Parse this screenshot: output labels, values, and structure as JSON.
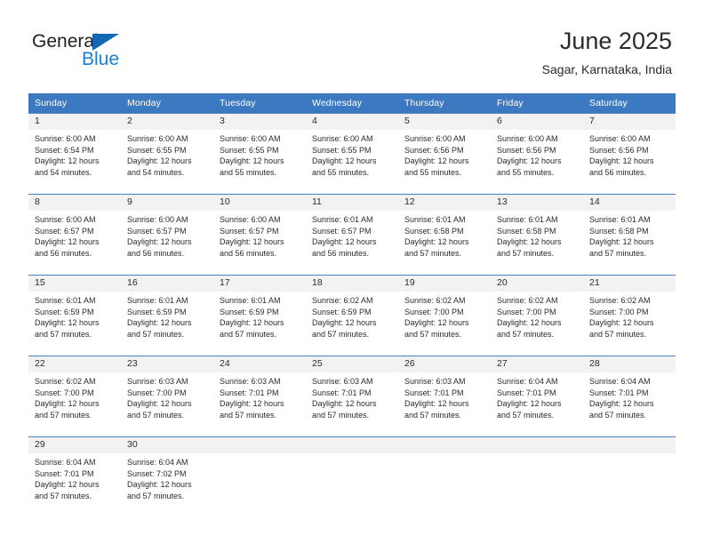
{
  "brand": {
    "name_top": "General",
    "name_bottom": "Blue",
    "triangle_color": "#1268b3",
    "blue_color": "#1a7fd4"
  },
  "header": {
    "title": "June 2025",
    "location": "Sagar, Karnataka, India"
  },
  "theme": {
    "header_blue": "#3d79c1",
    "daynum_strip": "#f2f2f2",
    "text": "#2b2b2b",
    "row_divider": "#4a7fc2"
  },
  "weekdays": [
    "Sunday",
    "Monday",
    "Tuesday",
    "Wednesday",
    "Thursday",
    "Friday",
    "Saturday"
  ],
  "weeks": [
    [
      {
        "day": "1",
        "sunrise": "Sunrise: 6:00 AM",
        "sunset": "Sunset: 6:54 PM",
        "daylight_line1": "Daylight: 12 hours",
        "daylight_line2": "and 54 minutes."
      },
      {
        "day": "2",
        "sunrise": "Sunrise: 6:00 AM",
        "sunset": "Sunset: 6:55 PM",
        "daylight_line1": "Daylight: 12 hours",
        "daylight_line2": "and 54 minutes."
      },
      {
        "day": "3",
        "sunrise": "Sunrise: 6:00 AM",
        "sunset": "Sunset: 6:55 PM",
        "daylight_line1": "Daylight: 12 hours",
        "daylight_line2": "and 55 minutes."
      },
      {
        "day": "4",
        "sunrise": "Sunrise: 6:00 AM",
        "sunset": "Sunset: 6:55 PM",
        "daylight_line1": "Daylight: 12 hours",
        "daylight_line2": "and 55 minutes."
      },
      {
        "day": "5",
        "sunrise": "Sunrise: 6:00 AM",
        "sunset": "Sunset: 6:56 PM",
        "daylight_line1": "Daylight: 12 hours",
        "daylight_line2": "and 55 minutes."
      },
      {
        "day": "6",
        "sunrise": "Sunrise: 6:00 AM",
        "sunset": "Sunset: 6:56 PM",
        "daylight_line1": "Daylight: 12 hours",
        "daylight_line2": "and 55 minutes."
      },
      {
        "day": "7",
        "sunrise": "Sunrise: 6:00 AM",
        "sunset": "Sunset: 6:56 PM",
        "daylight_line1": "Daylight: 12 hours",
        "daylight_line2": "and 56 minutes."
      }
    ],
    [
      {
        "day": "8",
        "sunrise": "Sunrise: 6:00 AM",
        "sunset": "Sunset: 6:57 PM",
        "daylight_line1": "Daylight: 12 hours",
        "daylight_line2": "and 56 minutes."
      },
      {
        "day": "9",
        "sunrise": "Sunrise: 6:00 AM",
        "sunset": "Sunset: 6:57 PM",
        "daylight_line1": "Daylight: 12 hours",
        "daylight_line2": "and 56 minutes."
      },
      {
        "day": "10",
        "sunrise": "Sunrise: 6:00 AM",
        "sunset": "Sunset: 6:57 PM",
        "daylight_line1": "Daylight: 12 hours",
        "daylight_line2": "and 56 minutes."
      },
      {
        "day": "11",
        "sunrise": "Sunrise: 6:01 AM",
        "sunset": "Sunset: 6:57 PM",
        "daylight_line1": "Daylight: 12 hours",
        "daylight_line2": "and 56 minutes."
      },
      {
        "day": "12",
        "sunrise": "Sunrise: 6:01 AM",
        "sunset": "Sunset: 6:58 PM",
        "daylight_line1": "Daylight: 12 hours",
        "daylight_line2": "and 57 minutes."
      },
      {
        "day": "13",
        "sunrise": "Sunrise: 6:01 AM",
        "sunset": "Sunset: 6:58 PM",
        "daylight_line1": "Daylight: 12 hours",
        "daylight_line2": "and 57 minutes."
      },
      {
        "day": "14",
        "sunrise": "Sunrise: 6:01 AM",
        "sunset": "Sunset: 6:58 PM",
        "daylight_line1": "Daylight: 12 hours",
        "daylight_line2": "and 57 minutes."
      }
    ],
    [
      {
        "day": "15",
        "sunrise": "Sunrise: 6:01 AM",
        "sunset": "Sunset: 6:59 PM",
        "daylight_line1": "Daylight: 12 hours",
        "daylight_line2": "and 57 minutes."
      },
      {
        "day": "16",
        "sunrise": "Sunrise: 6:01 AM",
        "sunset": "Sunset: 6:59 PM",
        "daylight_line1": "Daylight: 12 hours",
        "daylight_line2": "and 57 minutes."
      },
      {
        "day": "17",
        "sunrise": "Sunrise: 6:01 AM",
        "sunset": "Sunset: 6:59 PM",
        "daylight_line1": "Daylight: 12 hours",
        "daylight_line2": "and 57 minutes."
      },
      {
        "day": "18",
        "sunrise": "Sunrise: 6:02 AM",
        "sunset": "Sunset: 6:59 PM",
        "daylight_line1": "Daylight: 12 hours",
        "daylight_line2": "and 57 minutes."
      },
      {
        "day": "19",
        "sunrise": "Sunrise: 6:02 AM",
        "sunset": "Sunset: 7:00 PM",
        "daylight_line1": "Daylight: 12 hours",
        "daylight_line2": "and 57 minutes."
      },
      {
        "day": "20",
        "sunrise": "Sunrise: 6:02 AM",
        "sunset": "Sunset: 7:00 PM",
        "daylight_line1": "Daylight: 12 hours",
        "daylight_line2": "and 57 minutes."
      },
      {
        "day": "21",
        "sunrise": "Sunrise: 6:02 AM",
        "sunset": "Sunset: 7:00 PM",
        "daylight_line1": "Daylight: 12 hours",
        "daylight_line2": "and 57 minutes."
      }
    ],
    [
      {
        "day": "22",
        "sunrise": "Sunrise: 6:02 AM",
        "sunset": "Sunset: 7:00 PM",
        "daylight_line1": "Daylight: 12 hours",
        "daylight_line2": "and 57 minutes."
      },
      {
        "day": "23",
        "sunrise": "Sunrise: 6:03 AM",
        "sunset": "Sunset: 7:00 PM",
        "daylight_line1": "Daylight: 12 hours",
        "daylight_line2": "and 57 minutes."
      },
      {
        "day": "24",
        "sunrise": "Sunrise: 6:03 AM",
        "sunset": "Sunset: 7:01 PM",
        "daylight_line1": "Daylight: 12 hours",
        "daylight_line2": "and 57 minutes."
      },
      {
        "day": "25",
        "sunrise": "Sunrise: 6:03 AM",
        "sunset": "Sunset: 7:01 PM",
        "daylight_line1": "Daylight: 12 hours",
        "daylight_line2": "and 57 minutes."
      },
      {
        "day": "26",
        "sunrise": "Sunrise: 6:03 AM",
        "sunset": "Sunset: 7:01 PM",
        "daylight_line1": "Daylight: 12 hours",
        "daylight_line2": "and 57 minutes."
      },
      {
        "day": "27",
        "sunrise": "Sunrise: 6:04 AM",
        "sunset": "Sunset: 7:01 PM",
        "daylight_line1": "Daylight: 12 hours",
        "daylight_line2": "and 57 minutes."
      },
      {
        "day": "28",
        "sunrise": "Sunrise: 6:04 AM",
        "sunset": "Sunset: 7:01 PM",
        "daylight_line1": "Daylight: 12 hours",
        "daylight_line2": "and 57 minutes."
      }
    ],
    [
      {
        "day": "29",
        "sunrise": "Sunrise: 6:04 AM",
        "sunset": "Sunset: 7:01 PM",
        "daylight_line1": "Daylight: 12 hours",
        "daylight_line2": "and 57 minutes."
      },
      {
        "day": "30",
        "sunrise": "Sunrise: 6:04 AM",
        "sunset": "Sunset: 7:02 PM",
        "daylight_line1": "Daylight: 12 hours",
        "daylight_line2": "and 57 minutes."
      },
      {
        "day": "",
        "sunrise": "",
        "sunset": "",
        "daylight_line1": "",
        "daylight_line2": ""
      },
      {
        "day": "",
        "sunrise": "",
        "sunset": "",
        "daylight_line1": "",
        "daylight_line2": ""
      },
      {
        "day": "",
        "sunrise": "",
        "sunset": "",
        "daylight_line1": "",
        "daylight_line2": ""
      },
      {
        "day": "",
        "sunrise": "",
        "sunset": "",
        "daylight_line1": "",
        "daylight_line2": ""
      },
      {
        "day": "",
        "sunrise": "",
        "sunset": "",
        "daylight_line1": "",
        "daylight_line2": ""
      }
    ]
  ]
}
